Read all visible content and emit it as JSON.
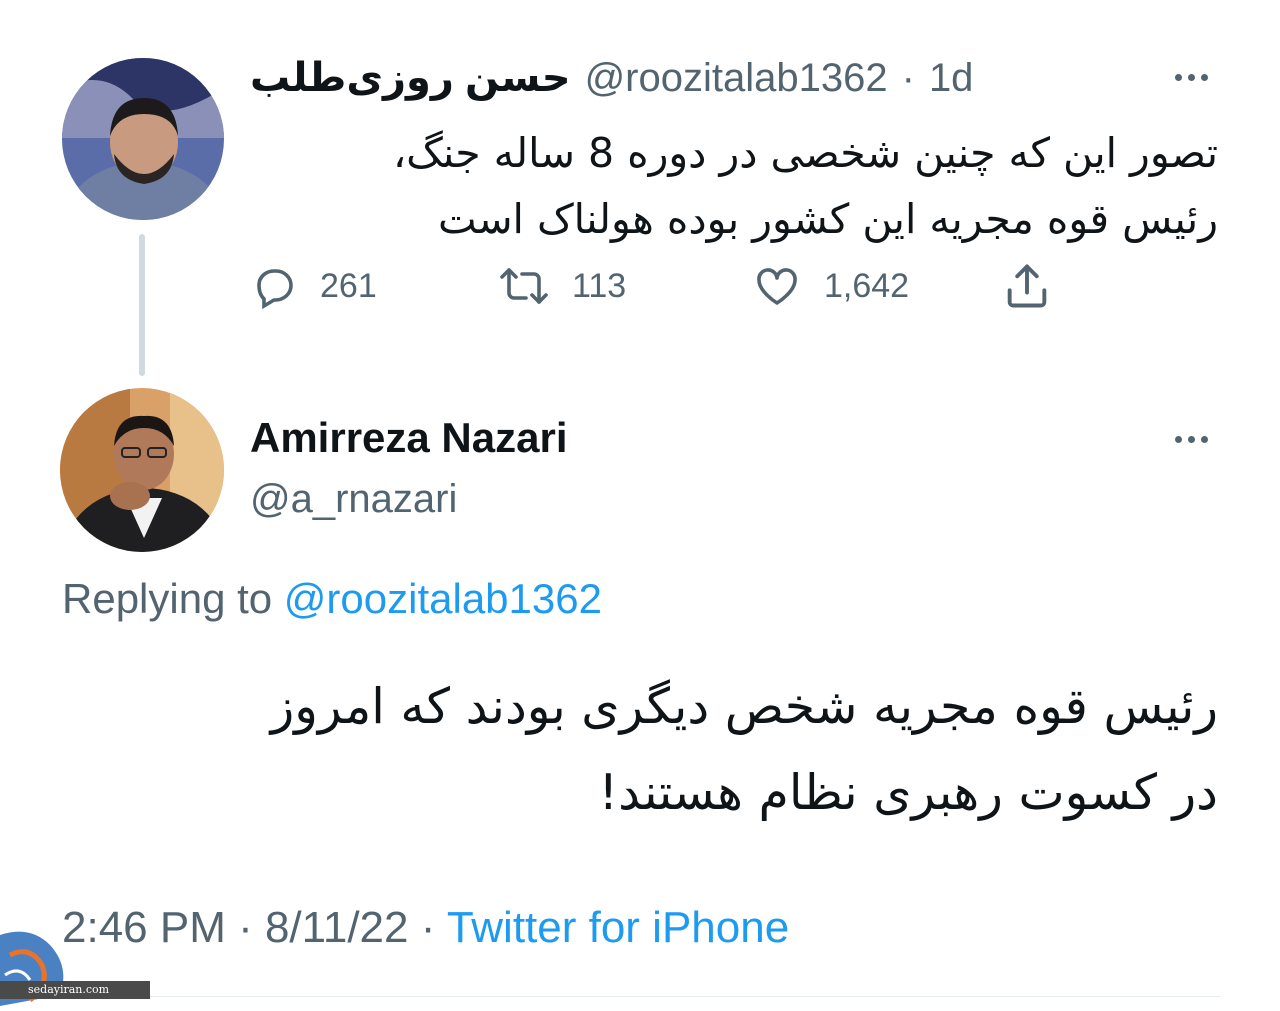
{
  "thread": {
    "tweets": [
      {
        "display_name": "حسن روزی‌طلب",
        "handle": "@roozitalab1362",
        "separator": "·",
        "time": "1d",
        "text_lines": [
          "تصور این که چنین شخصی در دوره 8 ساله جنگ،",
          "رئیس قوه مجریه این کشور بوده هولناک است"
        ],
        "stats": {
          "replies": "261",
          "retweets": "113",
          "likes": "1,642"
        }
      },
      {
        "display_name": "Amirreza Nazari",
        "handle": "@a_rnazari",
        "replying_label": "Replying to",
        "replying_to": "@roozitalab1362",
        "text_lines": [
          "رئیس قوه مجریه شخص دیگری بودند که امروز",
          "در کسوت رهبری نظام هستند!"
        ],
        "timestamp": "2:46 PM · 8/11/22 · ",
        "source": "Twitter for iPhone"
      }
    ]
  },
  "watermark": {
    "text": "sedayiran.com"
  },
  "colors": {
    "link": "#1d9bf0",
    "secondary_text": "#536471",
    "primary_text": "#0f1419",
    "thread_line": "#cfd9de"
  },
  "icons": [
    "more-icon",
    "reply-icon",
    "retweet-icon",
    "like-icon",
    "share-icon"
  ]
}
